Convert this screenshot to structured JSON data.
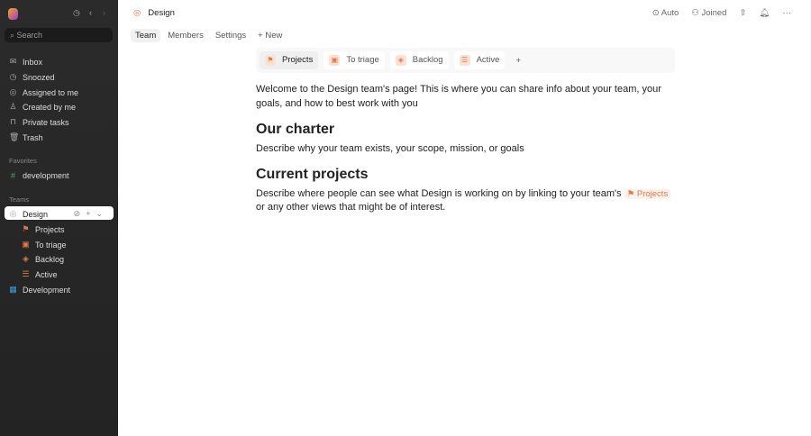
{
  "sidebar": {
    "search": "Search",
    "items": [
      {
        "label": "Inbox",
        "icon": "inbox-icon"
      },
      {
        "label": "Snoozed",
        "icon": "clock-icon"
      },
      {
        "label": "Assigned to me",
        "icon": "target-icon"
      },
      {
        "label": "Created by me",
        "icon": "user-icon"
      },
      {
        "label": "Private tasks",
        "icon": "lock-icon"
      },
      {
        "label": "Trash",
        "icon": "trash-icon"
      }
    ],
    "favorites_label": "Favorites",
    "favorites": [
      "development"
    ],
    "teams_label": "Teams",
    "teams": [
      {
        "label": "Design",
        "children": [
          "Projects",
          "To triage",
          "Backlog",
          "Active"
        ]
      },
      {
        "label": "Development"
      }
    ]
  },
  "header": {
    "title": "Design",
    "auto": "Auto",
    "joined": "Joined"
  },
  "tabs": [
    "Team",
    "Members",
    "Settings",
    "+ New"
  ],
  "views": [
    "Projects",
    "To triage",
    "Backlog",
    "Active"
  ],
  "doc": {
    "intro": "Welcome to the Design team's page! This is where you can share info about your team, your goals, and how to best work with you",
    "h1": "Our charter",
    "p1": "Describe why your team exists, your scope, mission, or goals",
    "h2": "Current projects",
    "p2a": "Describe where people can see what Design is working on by linking to your team's",
    "chip": "Projects",
    "p2b": "or any other views that might be of interest."
  },
  "colors": {
    "accent": "#e07a4a"
  }
}
